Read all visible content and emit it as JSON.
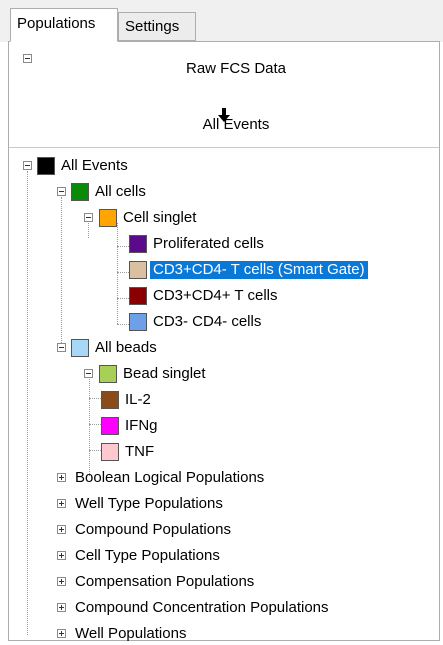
{
  "tabs": [
    {
      "label": "Populations",
      "active": true
    },
    {
      "label": "Settings",
      "active": false
    }
  ],
  "flow": {
    "source": "Raw FCS Data",
    "target": "All Events"
  },
  "tree": {
    "all_events": {
      "label": "All Events",
      "color": "#000000"
    },
    "all_cells": {
      "label": "All cells",
      "color": "#0a8a0a"
    },
    "cell_singlet": {
      "label": "Cell singlet",
      "color": "#ffa500"
    },
    "proliferated": {
      "label": "Proliferated cells",
      "color": "#5a0a8a"
    },
    "cd3_cd4_neg": {
      "label": "CD3+CD4- T cells (Smart Gate)",
      "color": "#d8c0a0",
      "selected": true
    },
    "cd3_cd4_pos": {
      "label": "CD3+CD4+ T cells",
      "color": "#8a0000"
    },
    "cd3_neg_cd4_neg": {
      "label": "CD3- CD4- cells",
      "color": "#6ea0e8"
    },
    "all_beads": {
      "label": "All beads",
      "color": "#a8d8f8"
    },
    "bead_singlet": {
      "label": "Bead singlet",
      "color": "#a8d058"
    },
    "il2": {
      "label": "IL-2",
      "color": "#8b4a1a"
    },
    "ifng": {
      "label": "IFNg",
      "color": "#ff00ff"
    },
    "tnf": {
      "label": "TNF",
      "color": "#ffc8d0"
    },
    "groups": [
      "Boolean Logical Populations",
      "Well Type Populations",
      "Compound Populations",
      "Cell Type Populations",
      "Compensation Populations",
      "Compound Concentration Populations",
      "Well Populations"
    ]
  }
}
